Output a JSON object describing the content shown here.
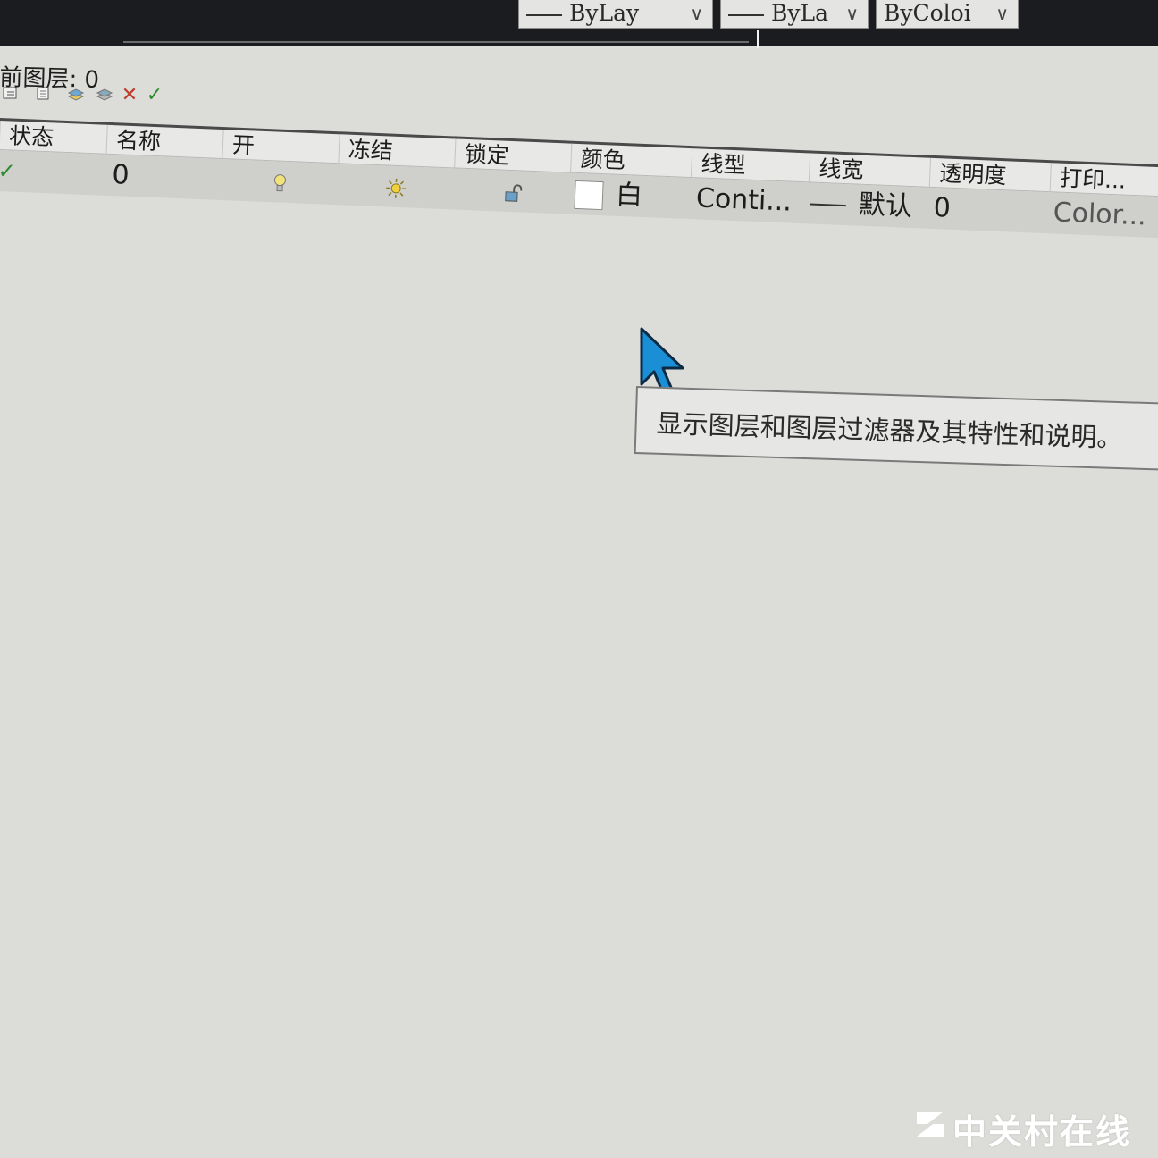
{
  "top_toolbar": {
    "dropdowns": [
      {
        "value": "ByLay"
      },
      {
        "value": "ByLa"
      },
      {
        "value": "ByColoi"
      }
    ]
  },
  "layer_panel": {
    "current_layer_label": "前图层: 0",
    "toolbar_icons": [
      "layer-states-icon",
      "new-layer-vp-icon",
      "new-layer-icon",
      "delete-layer-icon",
      "set-current-icon"
    ],
    "columns": [
      "状态",
      "名称",
      "开",
      "冻结",
      "锁定",
      "颜色",
      "线型",
      "线宽",
      "透明度",
      "打印..."
    ],
    "rows": [
      {
        "status": "✓",
        "name": "0",
        "on": "lightbulb-on-icon",
        "freeze": "sun-icon",
        "lock": "unlock-icon",
        "color_swatch": "#ffffff",
        "color": "白",
        "linetype": "Conti...",
        "lineweight": "默认",
        "transparency": "0",
        "plot_style": "Color..."
      }
    ]
  },
  "tooltip": {
    "text": "显示图层和图层过滤器及其特性和说明。"
  },
  "watermark": "中关村在线",
  "colors": {
    "accent_check": "#2e8b2e",
    "delete_red": "#c0392b",
    "cursor_blue": "#1a8fd6"
  }
}
